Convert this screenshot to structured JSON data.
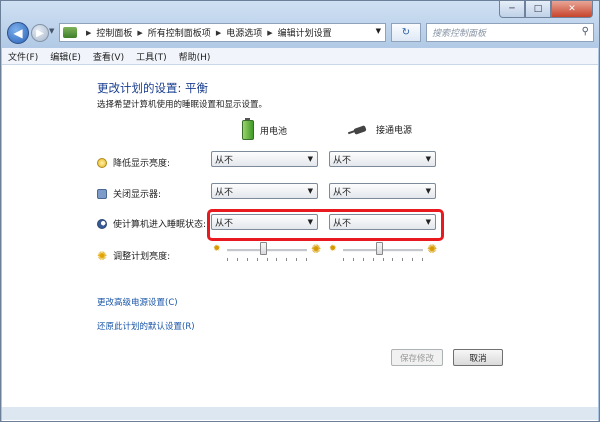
{
  "window": {
    "min": "─",
    "max": "□",
    "close": "✕"
  },
  "nav": {
    "back": "◀",
    "forward": "▶",
    "breadcrumb": [
      "控制面板",
      "所有控制面板项",
      "电源选项",
      "编辑计划设置"
    ],
    "refresh": "↻",
    "search_placeholder": "搜索控制面板"
  },
  "menu": [
    "文件(F)",
    "编辑(E)",
    "查看(V)",
    "工具(T)",
    "帮助(H)"
  ],
  "page": {
    "title": "更改计划的设置: 平衡",
    "subtitle": "选择希望计算机使用的睡眠设置和显示设置。",
    "col_battery": "用电池",
    "col_plugged": "接通电源",
    "rows": [
      {
        "label": "降低显示亮度:",
        "battery": "从不",
        "plugged": "从不"
      },
      {
        "label": "关闭显示器:",
        "battery": "从不",
        "plugged": "从不"
      },
      {
        "label": "使计算机进入睡眠状态:",
        "battery": "从不",
        "plugged": "从不"
      }
    ],
    "brightness_label": "调整计划亮度:",
    "brightness_battery_level": 0.45,
    "brightness_plugged_level": 0.45,
    "link_advanced": "更改高级电源设置(C)",
    "link_restore": "还原此计划的默认设置(R)",
    "save": "保存修改",
    "cancel": "取消"
  },
  "colors": {
    "highlight": "#e8191f",
    "link": "#1a56a8",
    "title": "#1a3f8f"
  }
}
